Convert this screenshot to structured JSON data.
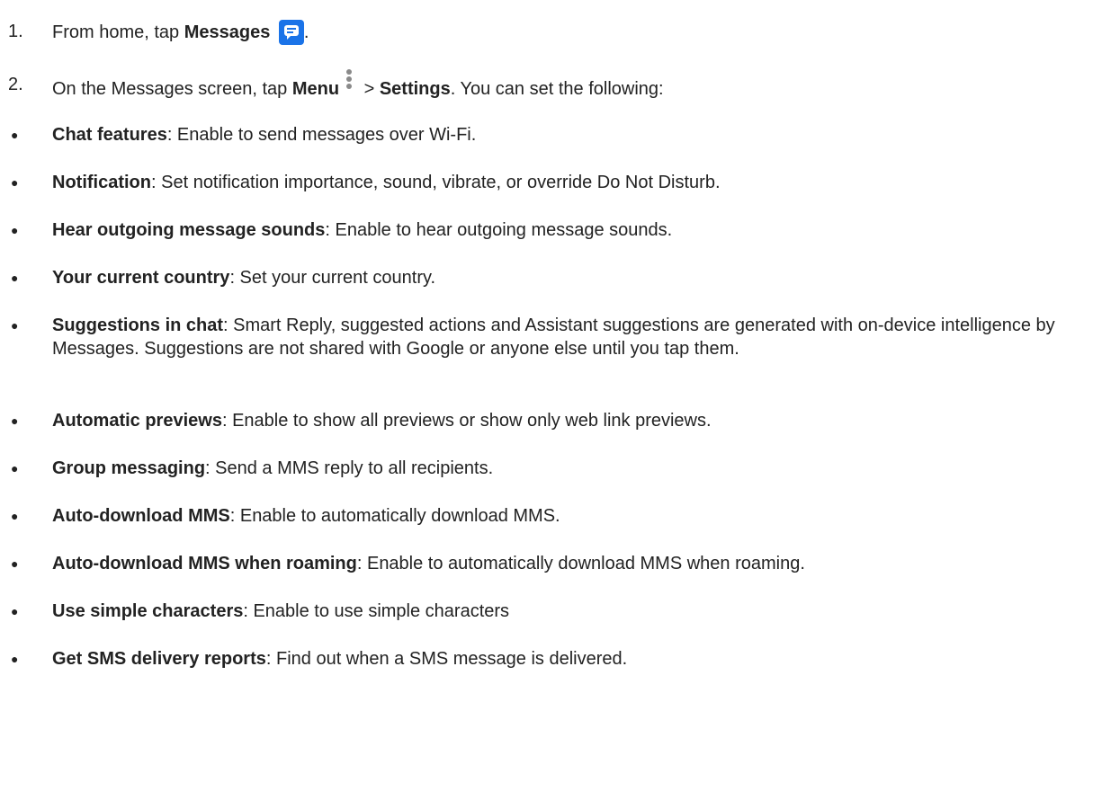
{
  "steps": [
    {
      "number": "1.",
      "pre": "From home, tap ",
      "bold": "Messages",
      "post": "."
    },
    {
      "number": "2.",
      "pre": "On the Messages screen, tap ",
      "bold1": "Menu",
      "mid": " > ",
      "bold2": "Settings",
      "post": ". You can set the following:"
    }
  ],
  "bullet_char": "●",
  "settings": [
    {
      "term": "Chat features",
      "desc": ": Enable to send messages over Wi-Fi."
    },
    {
      "term": "Notification",
      "desc": ": Set notification importance, sound, vibrate, or override Do Not Disturb."
    },
    {
      "term": "Hear outgoing message sounds",
      "desc": ": Enable to hear outgoing message sounds."
    },
    {
      "term": "Your current country",
      "desc": ": Set your current country."
    },
    {
      "term": "Suggestions in chat",
      "desc": ": Smart Reply, suggested actions and Assistant suggestions are generated with on-device intelligence by Messages. Suggestions are not shared with Google or anyone else until you tap them."
    },
    {
      "term": "Automatic previews",
      "desc": ": Enable to show all previews or show only web link previews."
    },
    {
      "term": "Group messaging",
      "desc": ": Send a MMS reply to all recipients."
    },
    {
      "term": "Auto-download MMS",
      "desc": ": Enable to automatically download MMS."
    },
    {
      "term": "Auto-download MMS when roaming",
      "desc": ": Enable to automatically download MMS when roaming."
    },
    {
      "term": "Use simple characters",
      "desc": ": Enable to use simple characters"
    },
    {
      "term": "Get SMS delivery reports",
      "desc": ": Find out when a SMS message is delivered."
    }
  ],
  "icons": {
    "messages": "messages-app-icon",
    "menu": "more-vert-icon",
    "accent": "#1a73e8"
  }
}
